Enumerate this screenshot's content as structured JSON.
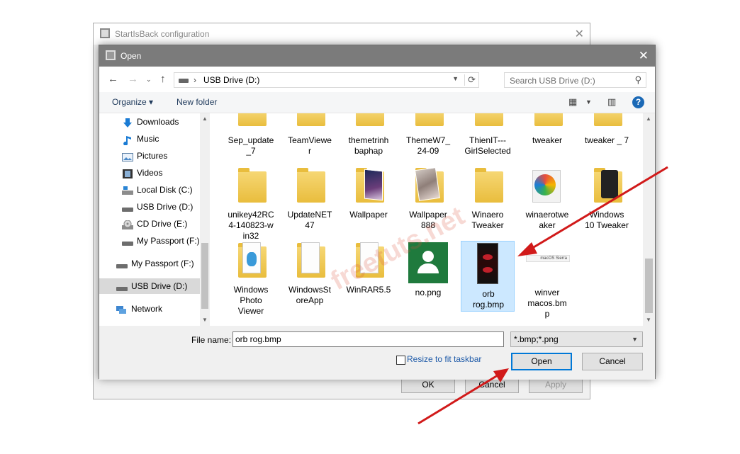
{
  "bg_window": {
    "title": "StartIsBack configuration",
    "ok_label": "OK",
    "cancel_label": "Cancel",
    "apply_label": "Apply"
  },
  "dialog": {
    "title": "Open",
    "address": {
      "separator": "›",
      "location": "USB Drive (D:)"
    },
    "search_placeholder": "Search USB Drive (D:)",
    "toolbar": {
      "organize": "Organize ▾",
      "new_folder": "New folder"
    },
    "nav_items": [
      {
        "label": "Downloads",
        "icon": "download-icon"
      },
      {
        "label": "Music",
        "icon": "music-icon"
      },
      {
        "label": "Pictures",
        "icon": "pictures-icon"
      },
      {
        "label": "Videos",
        "icon": "videos-icon"
      },
      {
        "label": "Local Disk (C:)",
        "icon": "local-disk-icon"
      },
      {
        "label": "USB Drive (D:)",
        "icon": "usb-drive-icon"
      },
      {
        "label": "CD Drive (E:)",
        "icon": "cd-drive-icon"
      },
      {
        "label": "My Passport (F:)",
        "icon": "drive-icon"
      },
      {
        "label": "My Passport (F:)",
        "icon": "drive-icon"
      },
      {
        "label": "USB Drive (D:)",
        "icon": "usb-drive-icon"
      },
      {
        "label": "Network",
        "icon": "network-icon"
      }
    ],
    "files": [
      {
        "name": "Sep_update\n_7",
        "kind": "folder"
      },
      {
        "name": "TeamViewe\nr",
        "kind": "folder"
      },
      {
        "name": "themetrinh\nbaphap",
        "kind": "folder"
      },
      {
        "name": "ThemeW7_\n24-09",
        "kind": "folder"
      },
      {
        "name": "ThienIT---\nGirlSelected",
        "kind": "folder"
      },
      {
        "name": "tweaker",
        "kind": "folder"
      },
      {
        "name": "tweaker _ 7",
        "kind": "folder"
      },
      {
        "name": "unikey42RC\n4-140823-w\nin32",
        "kind": "folder"
      },
      {
        "name": "UpdateNET\n47",
        "kind": "folder"
      },
      {
        "name": "Wallpaper",
        "kind": "folder-images"
      },
      {
        "name": "Wallpaper\n888",
        "kind": "folder-images"
      },
      {
        "name": "Winaero\nTweaker",
        "kind": "folder"
      },
      {
        "name": "winaerotwe\naker",
        "kind": "app"
      },
      {
        "name": "Windows\n10 Tweaker",
        "kind": "folder-app"
      },
      {
        "name": "Windows\nPhoto\nViewer",
        "kind": "folder-docs"
      },
      {
        "name": "WindowsSt\noreApp",
        "kind": "folder-docs"
      },
      {
        "name": "WinRAR5.5",
        "kind": "folder-docs"
      },
      {
        "name": "no.png",
        "kind": "png"
      },
      {
        "name": "orb\nrog.bmp",
        "kind": "bmp",
        "selected": true
      },
      {
        "name": "winver\nmacos.bm\np",
        "kind": "bmp-macos",
        "thumb_text": "macOS Sierra"
      }
    ],
    "watermark": "freetuts.net",
    "file_name_label": "File name:",
    "file_name_value": "orb rog.bmp",
    "file_type_value": "*.bmp;*.png",
    "resize_label": "Resize to fit taskbar",
    "open_label": "Open",
    "cancel_label": "Cancel",
    "accent_color": "#0078d7",
    "arrow_color": "#d11a1a"
  }
}
